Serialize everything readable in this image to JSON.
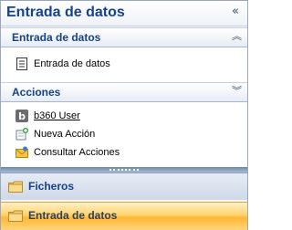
{
  "header": {
    "title": "Entrada de datos",
    "collapse_glyph": "«"
  },
  "groups": [
    {
      "title": "Entrada de datos",
      "toggle_glyph": "︽",
      "items": [
        {
          "label": "Entrada de datos",
          "icon": "document-icon"
        }
      ]
    },
    {
      "title": "Acciones",
      "toggle_glyph": "︾",
      "items": [
        {
          "label": "b360 User",
          "icon": "b360-icon"
        },
        {
          "label": "Nueva Acción",
          "icon": "new-action-icon"
        },
        {
          "label": "Consultar Acciones",
          "icon": "envelope-icon"
        }
      ]
    }
  ],
  "nav": {
    "ficheros": {
      "label": "Ficheros",
      "icon": "folder-icon"
    },
    "entrada": {
      "label": "Entrada de datos",
      "icon": "folder-icon"
    }
  },
  "colors": {
    "accent": "#15428b",
    "active_nav": "#ffc14d"
  }
}
